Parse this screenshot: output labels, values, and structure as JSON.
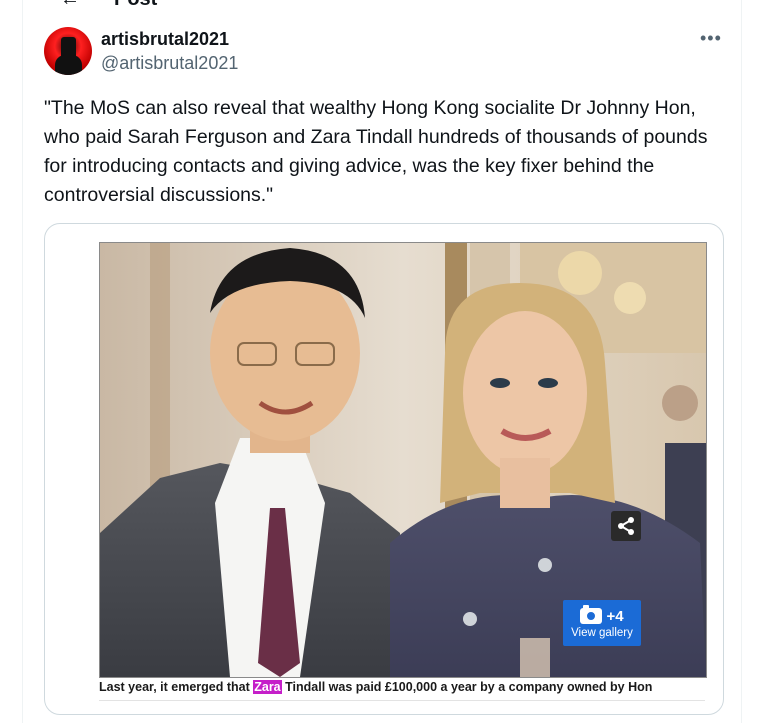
{
  "header": {
    "title": "Post",
    "back_icon": "back-arrow-icon"
  },
  "author": {
    "display_name": "artisbrutal2021",
    "handle": "@artisbrutal2021",
    "avatar_colors": [
      "#ff2020",
      "#111111"
    ]
  },
  "more_label": "•••",
  "tweet": {
    "text": "\"The MoS can also reveal that wealthy Hong Kong socialite Dr Johnny Hon, who paid Sarah Ferguson and Zara Tindall hundreds of thousands of pounds for introducing contacts and giving advice, was the key fixer behind the controversial discussions.\""
  },
  "media": {
    "gallery_count": "+4",
    "gallery_label": "View gallery",
    "share_icon": "share-icon",
    "camera_icon": "camera-icon",
    "caption_before": "Last year, it emerged that ",
    "caption_highlight": "Zara",
    "caption_after": " Tindall was paid £100,000 a year by a company owned by Hon",
    "highlight_color": "#c51fc9",
    "gallery_button_color": "#1b6bd6"
  }
}
